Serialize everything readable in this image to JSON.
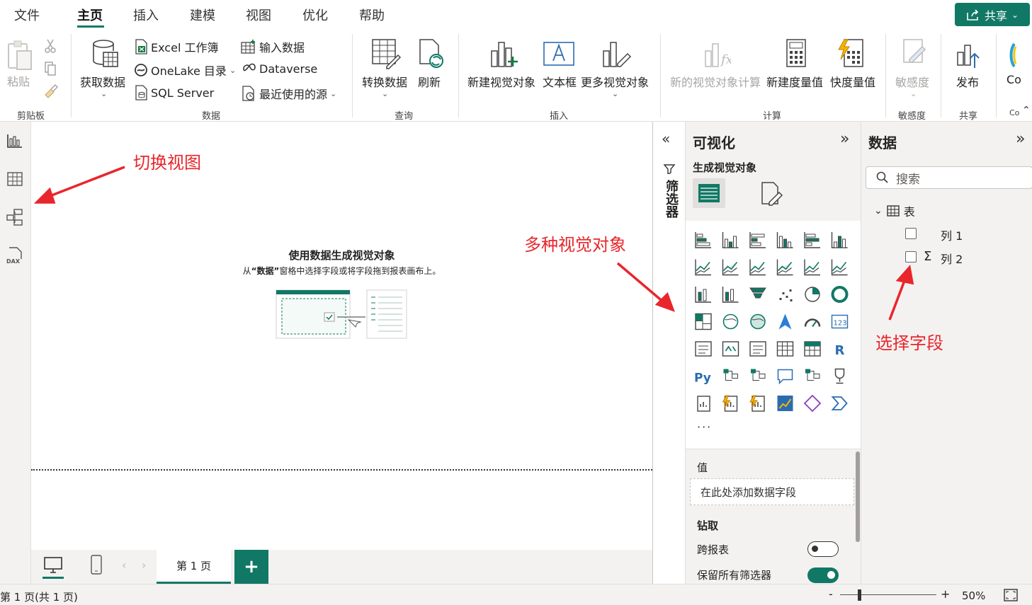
{
  "menu": {
    "tabs": [
      "文件",
      "主页",
      "插入",
      "建模",
      "视图",
      "优化",
      "帮助"
    ],
    "share_label": "共享"
  },
  "ribbon": {
    "clipboard": {
      "paste": "粘贴",
      "group": "剪贴板"
    },
    "data": {
      "get_data": "获取数据",
      "excel": "Excel 工作簿",
      "onelake": "OneLake 目录",
      "sql": "SQL Server",
      "enter_data": "输入数据",
      "dataverse": "Dataverse",
      "recent": "最近使用的源",
      "group": "数据"
    },
    "query": {
      "transform": "转换数据",
      "refresh": "刷新",
      "group": "查询"
    },
    "insert": {
      "new_visual": "新建视觉对象",
      "textbox": "文本框",
      "more_visuals": "更多视觉对象",
      "group": "插入"
    },
    "calc": {
      "new_visual_calc": "新的视觉对象计算",
      "new_measure": "新建度量值",
      "quick_measure": "快度量值",
      "group": "计算"
    },
    "sensitivity": {
      "label": "敏感度",
      "group": "敏感度"
    },
    "share": {
      "publish": "发布",
      "group": "共享"
    },
    "copilot": {
      "label": "Co",
      "group": "Co"
    }
  },
  "canvas": {
    "empty_title": "使用数据生成视觉对象",
    "empty_desc_prefix": "从",
    "empty_desc_quote": "“数据”",
    "empty_desc_suffix": "窗格中选择字段或将字段拖到报表画布上。"
  },
  "pagebar": {
    "page_tab": "第 1 页",
    "add": "+"
  },
  "filters": {
    "label": "筛选器"
  },
  "viz": {
    "title": "可视化",
    "subtitle": "生成视觉对象",
    "more": "···",
    "values_label": "值",
    "values_placeholder": "在此处添加数据字段",
    "drill_title": "钻取",
    "cross_report": "跨报表",
    "keep_filters": "保留所有筛选器",
    "cross_report_on": false,
    "keep_filters_on": true
  },
  "data": {
    "title": "数据",
    "search_placeholder": "搜索",
    "table_name": "表",
    "fields": [
      "列 1",
      "列 2"
    ]
  },
  "status": {
    "page_info": "第 1 页(共 1 页)",
    "zoom": "50%",
    "zoom_minus": "-",
    "zoom_plus": "+"
  },
  "annotations": {
    "switch_view": "切换视图",
    "multi_visuals": "多种视觉对象",
    "select_field": "选择字段"
  },
  "colors": {
    "accent": "#117865",
    "annotation": "#e8262b"
  }
}
